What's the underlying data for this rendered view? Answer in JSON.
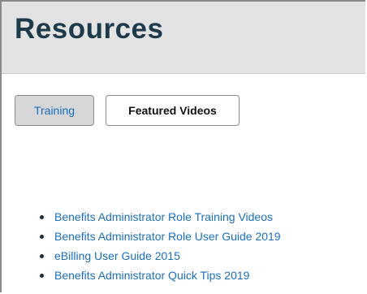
{
  "header": {
    "title": "Resources"
  },
  "tabs": [
    {
      "label": "Training",
      "active": true
    },
    {
      "label": "Featured Videos",
      "active": false
    }
  ],
  "resources": [
    {
      "label": "Benefits Administrator Role Training Videos"
    },
    {
      "label": "Benefits Administrator Role User Guide 2019"
    },
    {
      "label": "eBilling User Guide 2015"
    },
    {
      "label": "Benefits Administrator Quick Tips 2019"
    }
  ],
  "colors": {
    "header_bg": "#e3e3e3",
    "title": "#1f3a4b",
    "link": "#1a6fc0",
    "active_tab_bg": "#d7d7d7"
  }
}
